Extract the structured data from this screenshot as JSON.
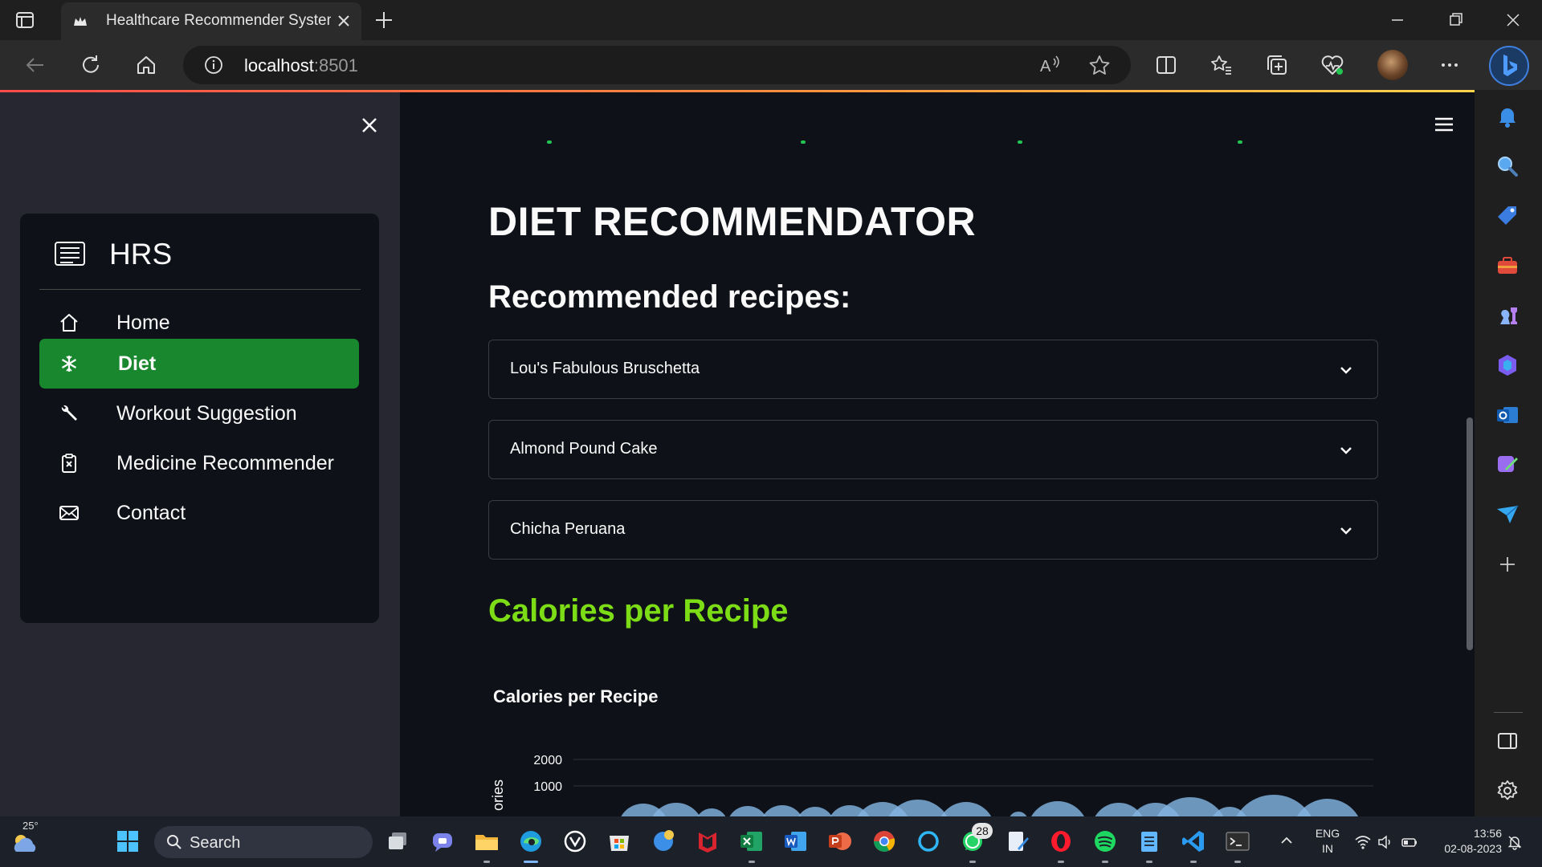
{
  "browser": {
    "tab_title": "Healthcare Recommender System",
    "url_host": "localhost",
    "url_port": ":8501"
  },
  "sidebar": {
    "brand": "HRS",
    "items": [
      {
        "label": "Home",
        "icon": "house-icon",
        "active": false
      },
      {
        "label": "Diet",
        "icon": "snowflake-icon",
        "active": true
      },
      {
        "label": "Workout Suggestion",
        "icon": "wrench-icon",
        "active": false
      },
      {
        "label": "Medicine Recommender",
        "icon": "clipboard-x-icon",
        "active": false
      },
      {
        "label": "Contact",
        "icon": "envelope-icon",
        "active": false
      }
    ]
  },
  "main": {
    "title": "DIET RECOMMENDATOR",
    "subtitle": "Recommended recipes:",
    "recipes": [
      "Lou's Fabulous Bruschetta",
      "Almond Pound Cake",
      "Chicha Peruana"
    ],
    "section_heading": "Calories per Recipe"
  },
  "chart_data": {
    "type": "scatter",
    "title": "Calories per Recipe",
    "ylabel": "ories",
    "yticks": [
      2000,
      1000
    ],
    "marker_color": "#83b3e0"
  },
  "colors": {
    "accent_green": "#18872d",
    "heading_green": "#7cdc15",
    "background": "#0e1117",
    "sidebar": "#262730"
  },
  "taskbar": {
    "temperature": "25°",
    "search_label": "Search",
    "notification_badge": "28",
    "lang_line1": "ENG",
    "lang_line2": "IN",
    "time": "13:56",
    "date": "02-08-2023"
  }
}
